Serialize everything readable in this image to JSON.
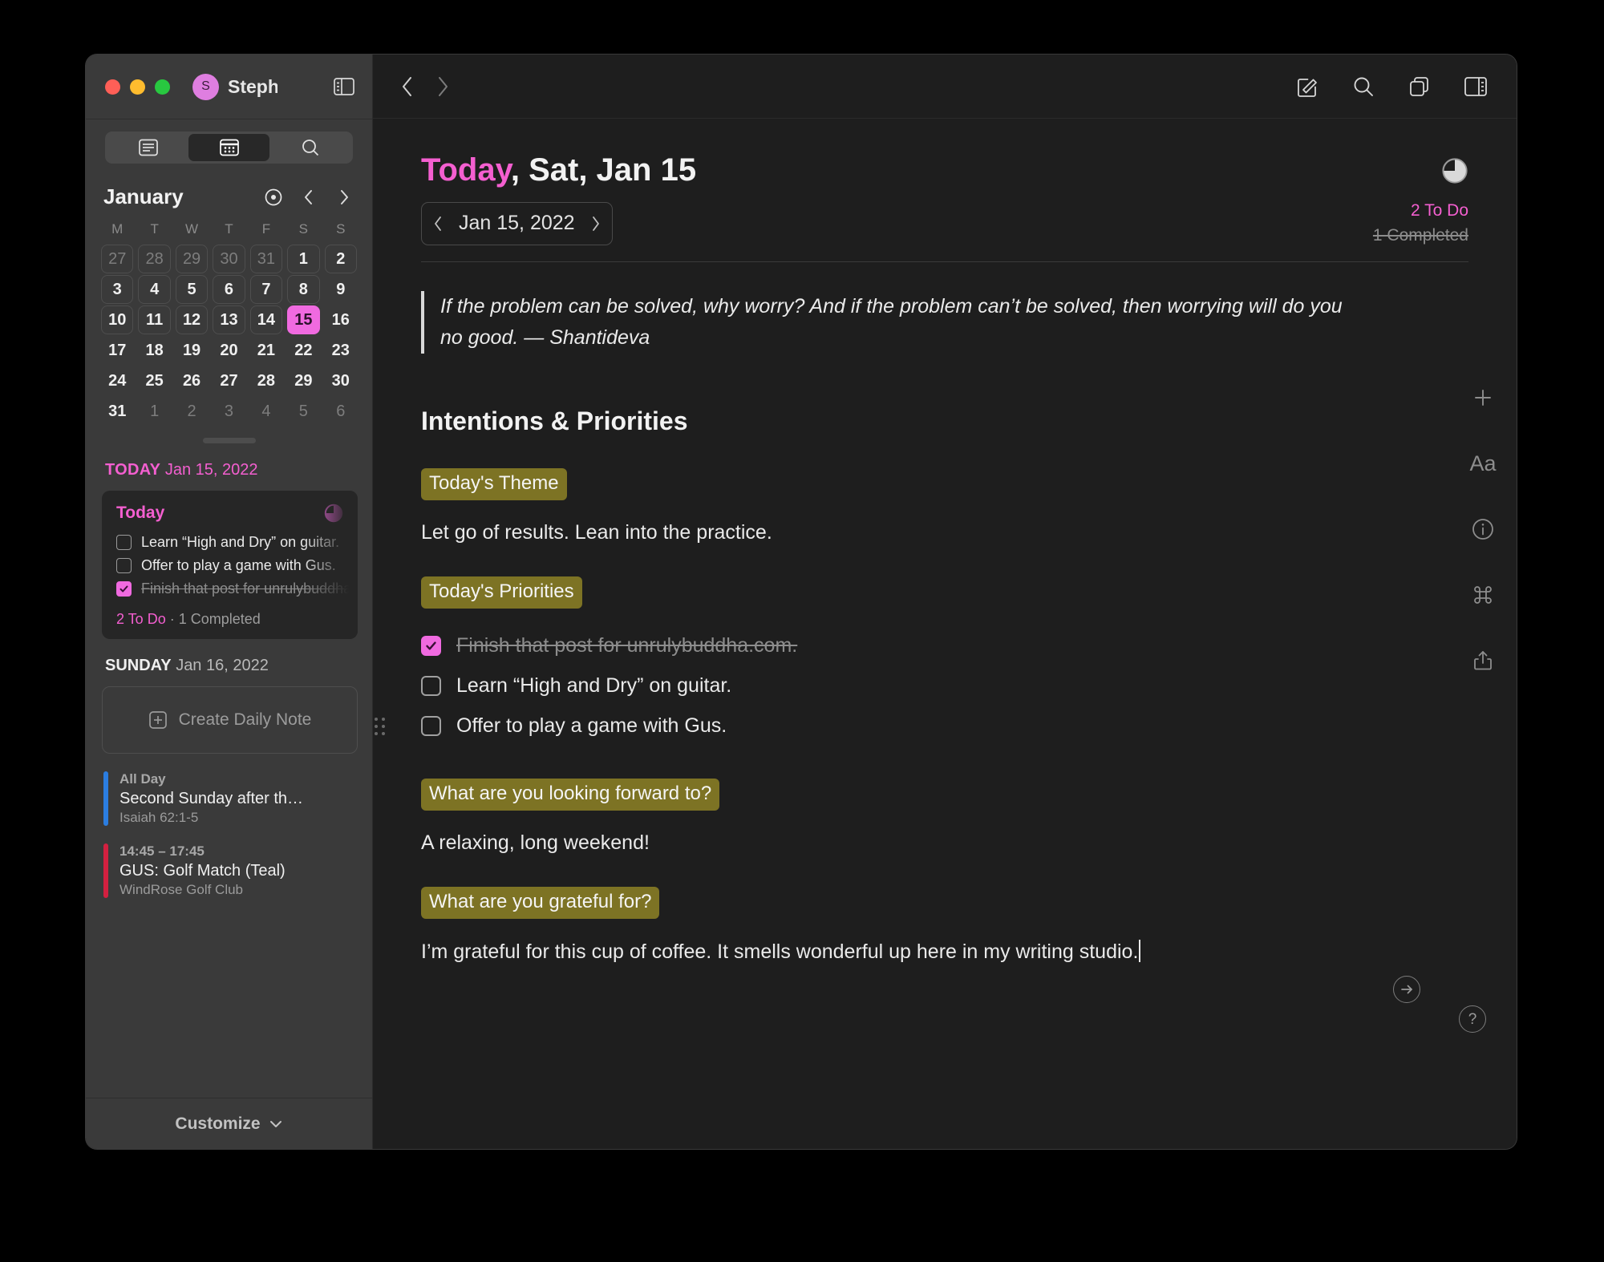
{
  "window": {
    "account_initial": "S",
    "account_name": "Steph",
    "accent_pink": "#f45fd0",
    "highlight_olive": "#7d7324"
  },
  "sidebar": {
    "view_tabs": [
      {
        "name": "notes-view",
        "icon": "list-lines-icon",
        "active": false
      },
      {
        "name": "calendar-view",
        "icon": "calendar-icon",
        "active": true
      },
      {
        "name": "search-view",
        "icon": "search-icon",
        "active": false
      }
    ],
    "calendar": {
      "month": "January",
      "controls": [
        "today-target-icon",
        "prev-month-icon",
        "next-month-icon"
      ],
      "dow": [
        "M",
        "T",
        "W",
        "T",
        "F",
        "S",
        "S"
      ],
      "weeks": [
        [
          {
            "d": "27",
            "state": "dim boxed"
          },
          {
            "d": "28",
            "state": "dim boxed"
          },
          {
            "d": "29",
            "state": "dim boxed"
          },
          {
            "d": "30",
            "state": "dim boxed"
          },
          {
            "d": "31",
            "state": "dim boxed"
          },
          {
            "d": "1",
            "state": "boxed"
          },
          {
            "d": "2",
            "state": "boxed"
          }
        ],
        [
          {
            "d": "3",
            "state": "boxed"
          },
          {
            "d": "4",
            "state": "boxed"
          },
          {
            "d": "5",
            "state": "boxed"
          },
          {
            "d": "6",
            "state": "boxed"
          },
          {
            "d": "7",
            "state": "boxed"
          },
          {
            "d": "8",
            "state": "boxed"
          },
          {
            "d": "9",
            "state": ""
          }
        ],
        [
          {
            "d": "10",
            "state": "boxed"
          },
          {
            "d": "11",
            "state": "boxed"
          },
          {
            "d": "12",
            "state": "boxed"
          },
          {
            "d": "13",
            "state": "boxed"
          },
          {
            "d": "14",
            "state": "boxed"
          },
          {
            "d": "15",
            "state": "today"
          },
          {
            "d": "16",
            "state": ""
          }
        ],
        [
          {
            "d": "17",
            "state": ""
          },
          {
            "d": "18",
            "state": ""
          },
          {
            "d": "19",
            "state": ""
          },
          {
            "d": "20",
            "state": ""
          },
          {
            "d": "21",
            "state": ""
          },
          {
            "d": "22",
            "state": ""
          },
          {
            "d": "23",
            "state": ""
          }
        ],
        [
          {
            "d": "24",
            "state": ""
          },
          {
            "d": "25",
            "state": ""
          },
          {
            "d": "26",
            "state": ""
          },
          {
            "d": "27",
            "state": ""
          },
          {
            "d": "28",
            "state": ""
          },
          {
            "d": "29",
            "state": ""
          },
          {
            "d": "30",
            "state": ""
          }
        ],
        [
          {
            "d": "31",
            "state": ""
          },
          {
            "d": "1",
            "state": "dim"
          },
          {
            "d": "2",
            "state": "dim"
          },
          {
            "d": "3",
            "state": "dim"
          },
          {
            "d": "4",
            "state": "dim"
          },
          {
            "d": "5",
            "state": "dim"
          },
          {
            "d": "6",
            "state": "dim"
          }
        ]
      ]
    },
    "today_section": {
      "label_bold": "TODAY",
      "label_date": "Jan 15, 2022",
      "card": {
        "title": "Today",
        "items": [
          {
            "text": "Learn “High and Dry” on guitar.",
            "done": false
          },
          {
            "text": "Offer to play a game with Gus.",
            "done": false
          },
          {
            "text": "Finish that post for unrulybuddha.com.",
            "done": true
          }
        ],
        "footer_todo": "2 To Do",
        "footer_sep": " · ",
        "footer_done": "1 Completed"
      }
    },
    "sunday_section": {
      "label_bold": "SUNDAY",
      "label_date": "Jan 16, 2022",
      "create_note_label": "Create Daily Note",
      "events": [
        {
          "time": "All Day",
          "title": "Second Sunday after th…",
          "location": "Isaiah 62:1-5",
          "color": "#2b7de0"
        },
        {
          "time": "14:45 – 17:45",
          "title": "GUS: Golf Match (Teal)",
          "location": "WindRose Golf Club",
          "color": "#d32040"
        }
      ]
    },
    "footer": {
      "label": "Customize",
      "icon": "chevron-down-icon"
    }
  },
  "main": {
    "toolbar": {
      "back_icon": "chevron-left-icon",
      "forward_icon": "chevron-right-icon",
      "icons": [
        "compose-icon",
        "search-icon",
        "duplicate-icon",
        "right-sidebar-icon"
      ]
    },
    "header": {
      "title_pink": "Today",
      "title_rest": ", Sat, Jan 15",
      "pie_icon": "progress-pie-icon"
    },
    "date_picker": {
      "prev_icon": "chevron-left-icon",
      "value": "Jan 15, 2022",
      "next_icon": "chevron-right-icon"
    },
    "counts": {
      "todo": "2 To Do",
      "completed": "1 Completed"
    },
    "quote": {
      "text": "If the problem can be solved, why worry? And if the problem can’t be solved, then worrying will do you no good. — Shantideva"
    },
    "section_heading": "Intentions & Priorities",
    "blocks": [
      {
        "label": "Today's Theme",
        "body": "Let go of results. Lean into the practice."
      }
    ],
    "priorities_label": "Today's Priorities",
    "priorities": [
      {
        "text": "Finish that post for unrulybuddha.com.",
        "done": true
      },
      {
        "text": "Learn “High and Dry” on guitar.",
        "done": false
      },
      {
        "text": "Offer to play a game with Gus.",
        "done": false
      }
    ],
    "forward_label": "What are you looking forward to?",
    "forward_body": "A relaxing, long weekend!",
    "grateful_label": "What are you grateful for?",
    "grateful_body": "I’m grateful for this cup of coffee. It smells wonderful up here in my writing studio.",
    "rail_icons": [
      "plus-icon",
      "text-format-icon",
      "info-icon",
      "command-icon",
      "share-icon"
    ],
    "rail_aa": "Aa",
    "bottom_icons": [
      "arrow-right-circle-icon",
      "help-circle-icon"
    ]
  }
}
